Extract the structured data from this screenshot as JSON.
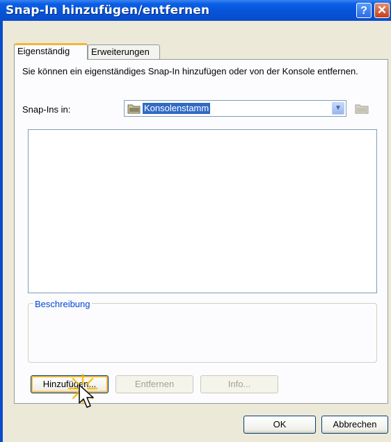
{
  "window": {
    "title": "Snap-In hinzufügen/entfernen",
    "help_glyph": "?",
    "close_glyph": "✕"
  },
  "tabs": [
    {
      "label": "Eigenständig",
      "active": true
    },
    {
      "label": "Erweiterungen",
      "active": false
    }
  ],
  "panel": {
    "description": "Sie können ein eigenständiges Snap-In hinzufügen oder von der Konsole entfernen.",
    "snapins_label": "Snap-Ins in:",
    "combo_value": "Konsolenstamm",
    "list_items": [],
    "group_label": "Beschreibung",
    "group_text": ""
  },
  "buttons": {
    "add": "Hinzufügen...",
    "remove": "Entfernen",
    "info": "Info...",
    "ok": "OK",
    "cancel": "Abbrechen"
  },
  "colors": {
    "titlebar": "#0a5fe6",
    "selection": "#316ac5",
    "group_label": "#0046d5",
    "focus_highlight": "#f7b93e"
  },
  "icons": [
    "help-icon",
    "close-icon",
    "folder-icon",
    "dropdown-arrow-icon",
    "folder-up-icon",
    "mouse-cursor-icon",
    "click-highlight-icon"
  ]
}
